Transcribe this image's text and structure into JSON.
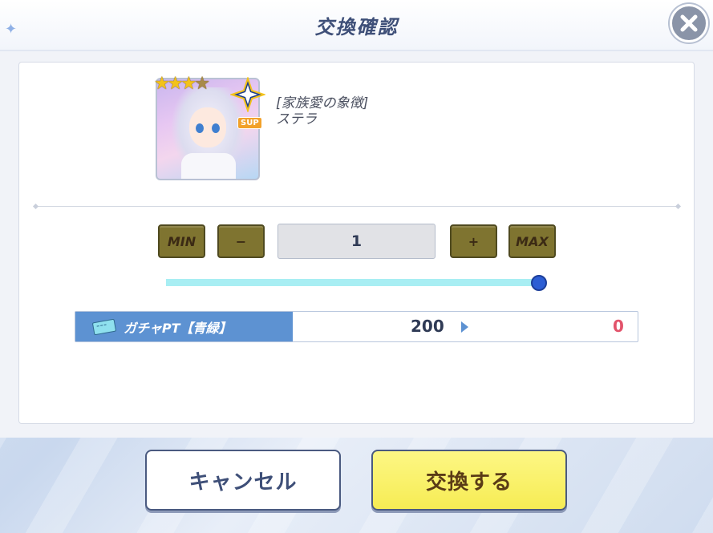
{
  "dialog": {
    "title": "交換確認",
    "close_icon": "close-icon"
  },
  "item": {
    "stars_filled": 3,
    "stars_total": 5,
    "type_badge": "SUP",
    "title": "[家族愛の象徴]",
    "name": "ステラ"
  },
  "quantity": {
    "min_label": "MIN",
    "minus_label": "−",
    "value": "1",
    "plus_label": "+",
    "max_label": "MAX",
    "slider_fraction": 1.0
  },
  "exchange": {
    "currency_icon": "ticket-icon",
    "currency_label": "ガチャPT【青緑】",
    "amount_before": "200",
    "amount_after": "0"
  },
  "actions": {
    "cancel_label": "キャンセル",
    "confirm_label": "交換する"
  },
  "colors": {
    "accent_blue": "#5d92d2",
    "after_amount": "#e2536b",
    "confirm_yellow": "#f6ec54",
    "stepper_olive": "#7f7430"
  }
}
